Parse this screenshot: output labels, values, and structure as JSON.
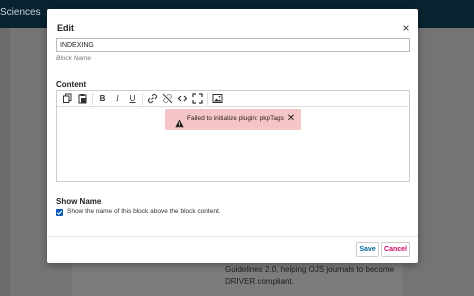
{
  "background": {
    "topbar_text": "Sciences",
    "body_text": "Guidelines 2.0, helping OJS journals to become DRIVER compliant."
  },
  "modal": {
    "title": "Edit",
    "close_symbol": "×",
    "name_field": {
      "value": "INDEXING",
      "helper": "Block Name"
    },
    "content_label": "Content",
    "toolbar_icons": [
      "copy-icon",
      "paste-icon",
      "bold-icon",
      "italic-icon",
      "underline-icon",
      "link-icon",
      "unlink-icon",
      "code-icon",
      "fullscreen-icon",
      "image-icon"
    ],
    "error": {
      "message": "Failed to initialize plugin: pkpTags",
      "close_symbol": "✕"
    },
    "show_name": {
      "label": "Show Name",
      "checkbox_label": "Show the name of this block above the block content.",
      "checked": true
    },
    "buttons": {
      "save": "Save",
      "cancel": "Cancel"
    }
  },
  "colors": {
    "accent": "#006798",
    "cancel": "#d00a6c",
    "error_bg": "#f5c6c6",
    "checkbox": "#0a5bb5"
  }
}
